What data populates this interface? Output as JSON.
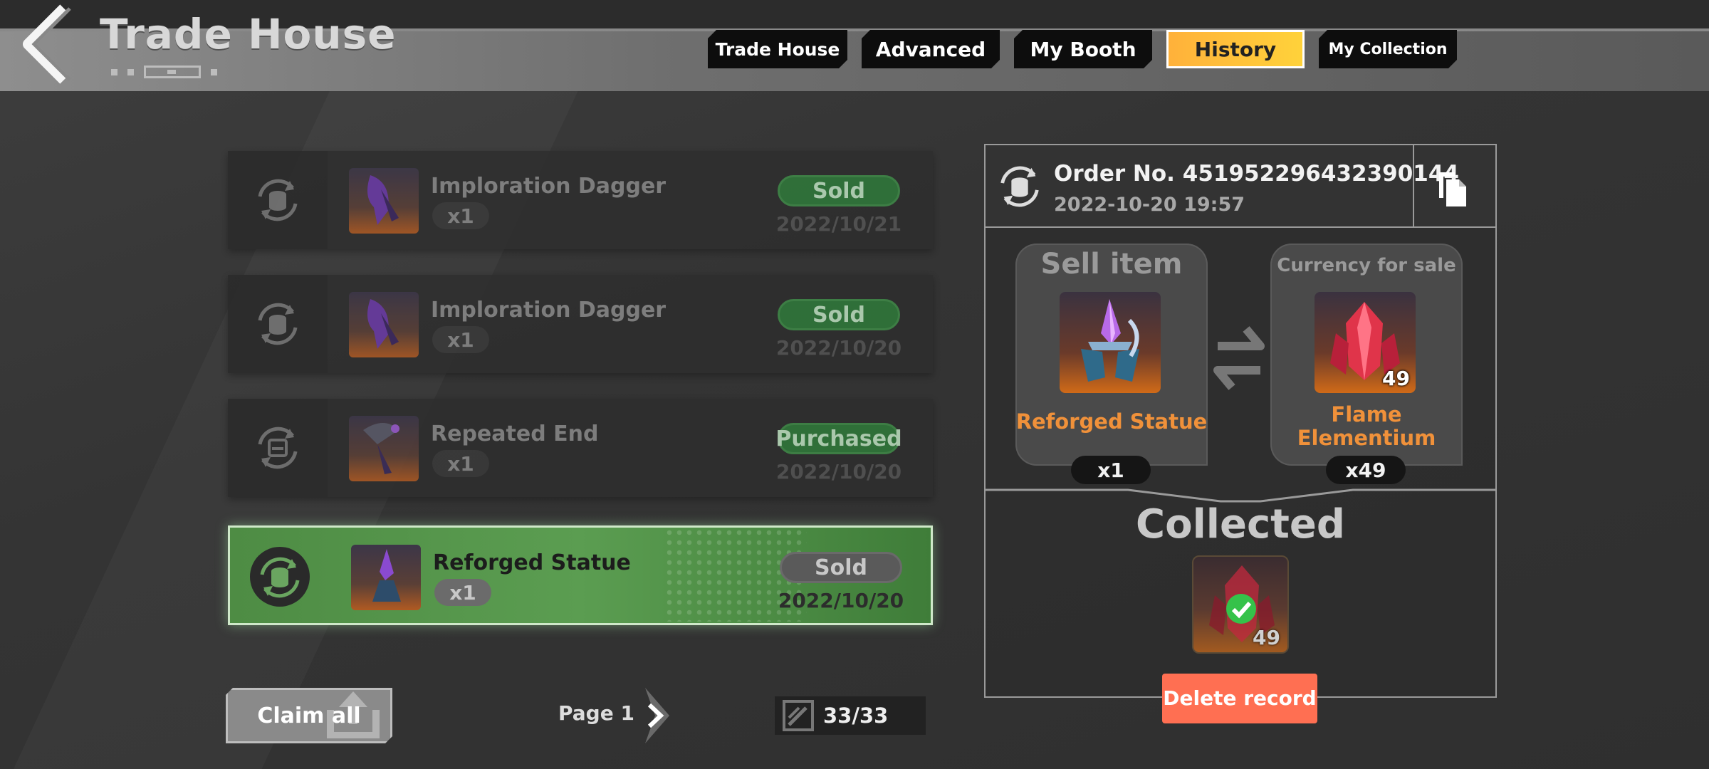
{
  "header": {
    "title": "Trade House",
    "tabs": [
      {
        "label": "Trade House",
        "active": false
      },
      {
        "label": "Advanced",
        "active": false
      },
      {
        "label": "My Booth",
        "active": false
      },
      {
        "label": "History",
        "active": true
      },
      {
        "label": "My Collection",
        "active": false
      }
    ]
  },
  "history": {
    "rows": [
      {
        "name": "Imploration Dagger",
        "qty": "x1",
        "status": "Sold",
        "date": "2022/10/21",
        "selected": false
      },
      {
        "name": "Imploration Dagger",
        "qty": "x1",
        "status": "Sold",
        "date": "2022/10/20",
        "selected": false
      },
      {
        "name": "Repeated End",
        "qty": "x1",
        "status": "Purchased",
        "date": "2022/10/20",
        "selected": false
      },
      {
        "name": "Reforged Statue",
        "qty": "x1",
        "status": "Sold",
        "date": "2022/10/20",
        "selected": true
      }
    ]
  },
  "footer": {
    "claim_label": "Claim all",
    "page_label": "Page 1",
    "counter": "33/33"
  },
  "detail": {
    "order_no": "Order No. 451952296432390144",
    "order_time": "2022-10-20 19:57",
    "sell": {
      "title": "Sell item",
      "name": "Reforged Statue",
      "qty": "x1"
    },
    "currency": {
      "title": "Currency for sale",
      "name": "Flame Elementium",
      "qty": "x49",
      "badge": "49"
    },
    "collected_title": "Collected",
    "collected_badge": "49",
    "delete_label": "Delete record"
  },
  "colors": {
    "accent_tab": "#ffc83a",
    "sold_green": "#2f7a3a",
    "selected_row": "#5b9d51",
    "item_name_orange": "#f0913a",
    "delete_button": "#ff6f52"
  },
  "icons": [
    "back-chevron-icon",
    "currency-exchange-icon",
    "copy-icon",
    "swap-arrows-icon",
    "next-page-icon",
    "edit-icon",
    "check-icon"
  ]
}
